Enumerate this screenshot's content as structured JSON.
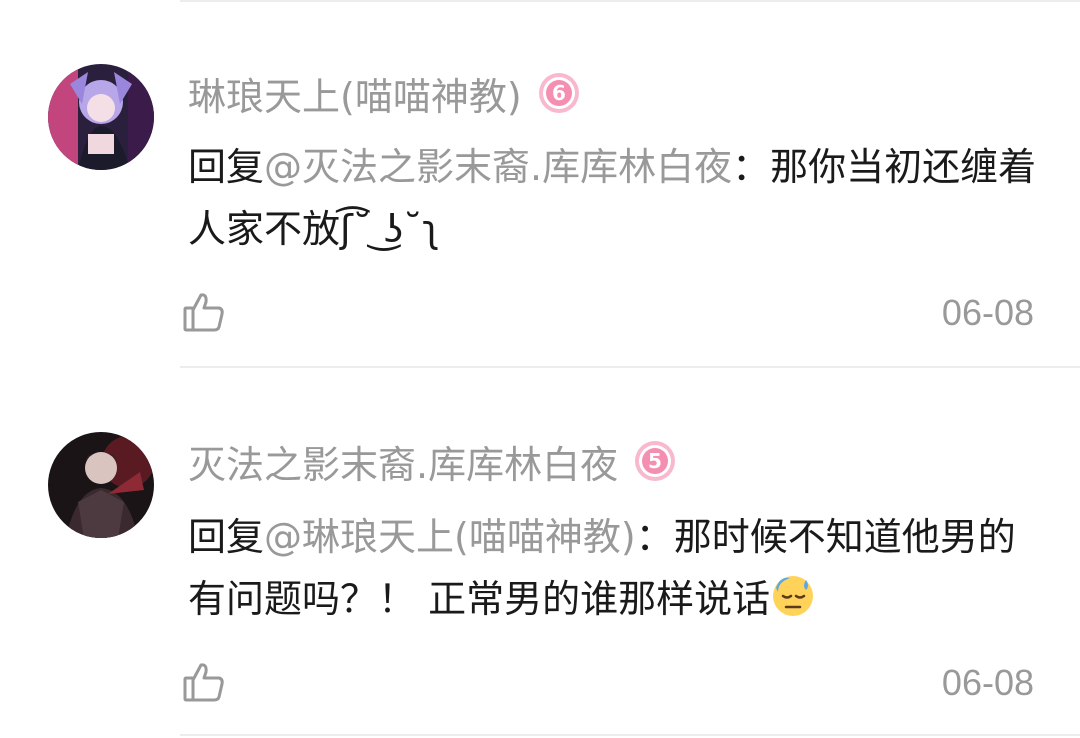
{
  "comments": [
    {
      "username": "琳琅天上(喵喵神教)",
      "level": "6",
      "reply_prefix": "回复",
      "mention": "@灭法之影末裔.库库林白夜",
      "colon": "：",
      "text": "那你当初还缠着人家不放ʃ͡˘ ͜ʖ˘ʅ",
      "date": "06-08",
      "badge_color": "#f4a6bd"
    },
    {
      "username": "灭法之影末裔.库库林白夜",
      "level": "5",
      "reply_prefix": "回复",
      "mention": "@琳琅天上(喵喵神教)",
      "colon": "：",
      "text": "那时候不知道他男的有问题吗？！ 正常男的谁那样说话",
      "emoji_name": "downcast-face-with-sweat-emoji",
      "date": "06-08",
      "badge_color": "#f4a6bd"
    }
  ]
}
